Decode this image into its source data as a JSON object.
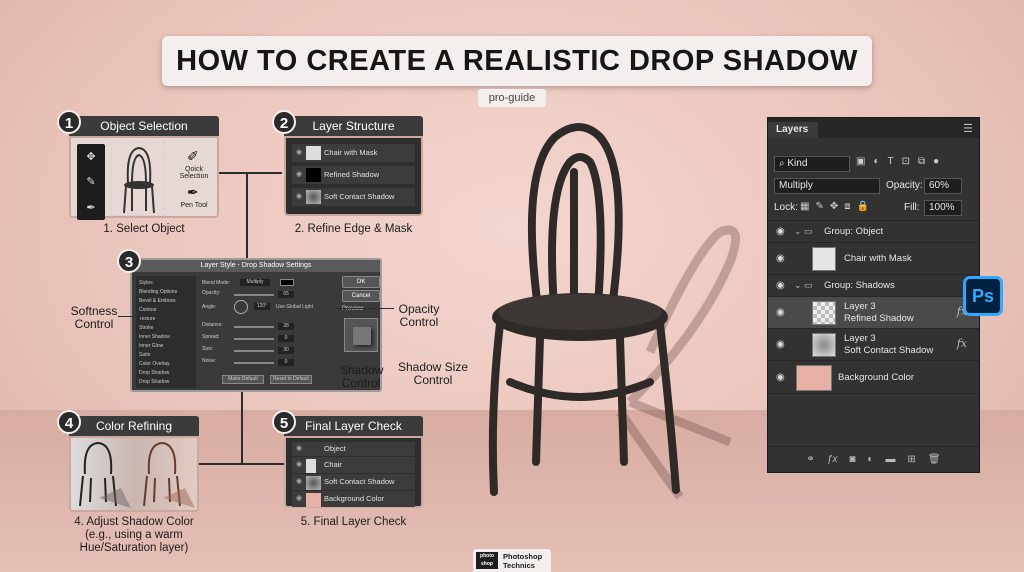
{
  "title": "HOW TO CREATE A REALISTIC DROP SHADOW",
  "tag": "pro-guide",
  "steps": {
    "s1": {
      "num": "1",
      "header": "Object Selection",
      "caption": "1. Select Object",
      "quick": "Qoick Selection",
      "pen": "Pen Tool"
    },
    "s2": {
      "num": "2",
      "header": "Layer Structure",
      "caption": "2. Refine Edge & Mask",
      "layers": [
        "Chair with Mask",
        "Refined Shadow",
        "Soft Contact Shadow"
      ]
    },
    "s3": {
      "num": "3",
      "dialog_title": "Layer Style - Drop Shadow Settings",
      "ok": "OK",
      "cancel": "Cancel",
      "preview": "Preview",
      "styles_head": "Styles",
      "styles": [
        "Blending Options",
        "Bevel & Emboss",
        "Contour",
        "Texture",
        "Stroke",
        "Inner Shadow",
        "Inner Glow",
        "Satin",
        "Color Overlay",
        "Drop Shadow",
        "Drop Shadow"
      ],
      "fields": [
        "Blend Mode:",
        "Opacity:",
        "Angle:",
        "Distance:",
        "Spread:",
        "Size:",
        "Noise:"
      ],
      "values": [
        "Multiply",
        "65",
        "120°",
        "28",
        "0",
        "30",
        "0"
      ],
      "use_global": "Use Global Light",
      "make_default": "Make Default",
      "reset_default": "Reset to Default"
    },
    "s4": {
      "num": "4",
      "header": "Color Refining",
      "caption": "4. Adjust Shadow Color\n(e.g., using a warm\nHue/Saturation layer)"
    },
    "s5": {
      "num": "5",
      "header": "Final Layer Check",
      "caption": "5. Final Layer Check",
      "layers": [
        "Object",
        "Chair",
        "Soft Contact Shadow",
        "Background Color"
      ]
    }
  },
  "callouts": {
    "softness": "Softness\nControl",
    "opacity": "Opacity\nControl",
    "shadow": "Shadow\nControl",
    "size": "Shadow Size\nControl"
  },
  "layers_panel": {
    "tab": "Layers",
    "kind": "Kind",
    "blend_mode": "Multiply",
    "opacity_label": "Opacity:",
    "opacity_value": "60%",
    "lock_label": "Lock:",
    "fill_label": "Fill:",
    "fill_value": "100%",
    "group_object": "Group: Object",
    "chair_mask": "Chair with Mask",
    "group_shadows": "Group: Shadows",
    "layer3a": "Layer 3",
    "refined": "Refined Shadow",
    "layer3b": "Layer 3",
    "soft_contact": "Soft Contact Shadow",
    "background": "Background Color",
    "fx": "fx"
  },
  "ps_badge": "Ps",
  "brand": {
    "logo": "photo shop",
    "line1": "Photoshop",
    "line2": "Technics"
  },
  "colors": {
    "background": "#e9c3ba",
    "panel": "#323232",
    "ps_blue": "#31a8ff",
    "bg_swatch": "#e8b1a6"
  }
}
